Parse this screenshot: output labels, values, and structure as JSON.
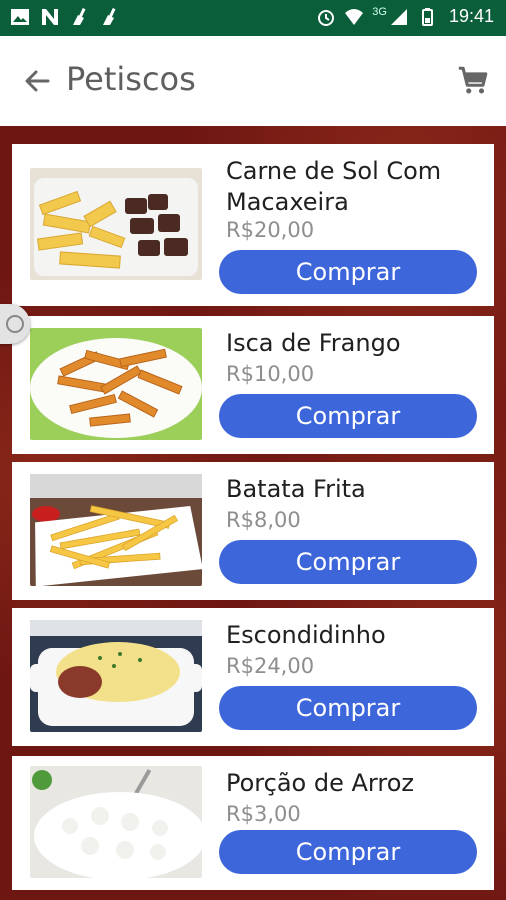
{
  "statusbar": {
    "network": "3G",
    "time": "19:41"
  },
  "appbar": {
    "title": "Petiscos"
  },
  "products": [
    {
      "name_line1": "Carne de Sol Com",
      "name_line2": "Macaxeira",
      "price": "R$20,00",
      "button": "Comprar"
    },
    {
      "name_line1": "Isca de Frango",
      "price": "R$10,00",
      "button": "Comprar"
    },
    {
      "name_line1": "Batata Frita",
      "price": "R$8,00",
      "button": "Comprar"
    },
    {
      "name_line1": "Escondidinho",
      "price": "R$24,00",
      "button": "Comprar"
    },
    {
      "name_line1": "Porção de Arroz",
      "price": "R$3,00",
      "button": "Comprar"
    }
  ],
  "colors": {
    "statusbar": "#0b5e3a",
    "button": "#3d66db",
    "background": "#6e1612"
  }
}
